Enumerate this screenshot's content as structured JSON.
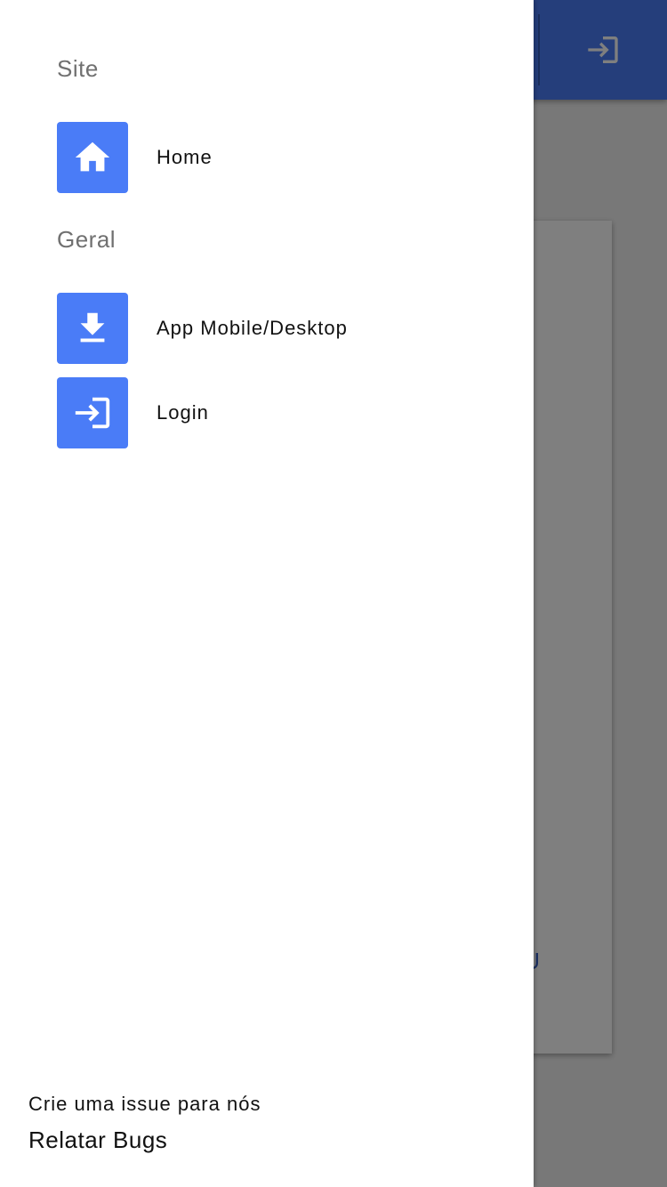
{
  "drawer": {
    "sections": [
      {
        "title": "Site",
        "items": [
          {
            "label": "Home",
            "icon": "home-icon"
          }
        ]
      },
      {
        "title": "Geral",
        "items": [
          {
            "label": "App Mobile/Desktop",
            "icon": "download-icon"
          },
          {
            "label": "Login",
            "icon": "login-icon"
          }
        ]
      }
    ],
    "footer": {
      "subtitle": "Crie uma issue para nós",
      "link_label": "Relatar Bugs"
    }
  },
  "background": {
    "card_link_partial": "U",
    "appbar_action_icon": "login-icon"
  },
  "colors": {
    "accent": "#4a7cf7",
    "scrim": "rgba(0,0,0,0.5)",
    "section_title": "#707070",
    "text": "#111111"
  }
}
